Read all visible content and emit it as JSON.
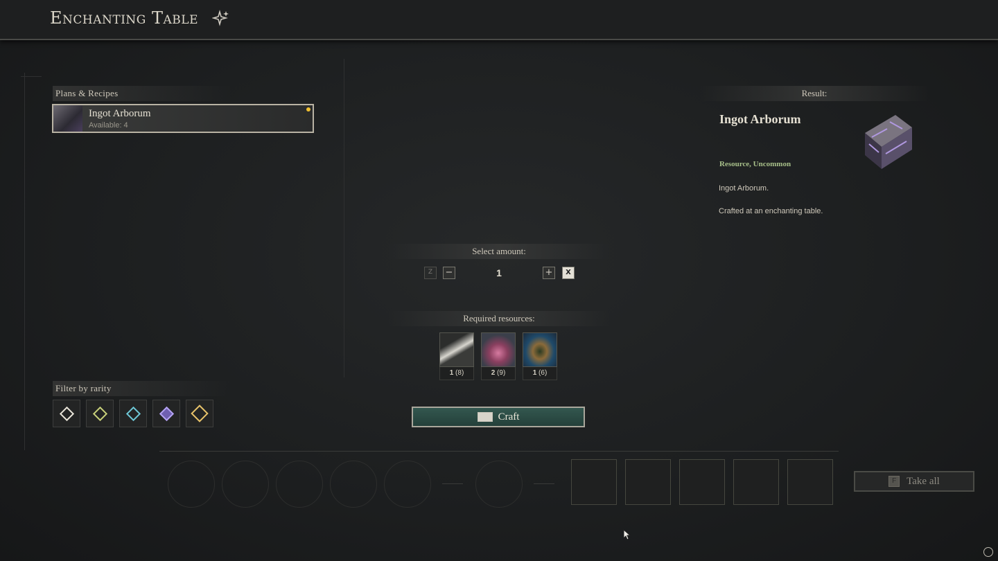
{
  "window": {
    "title": "Enchanting Table"
  },
  "plans": {
    "label": "Plans & Recipes",
    "items": [
      {
        "name": "Ingot Arborum",
        "available": "Available: 4"
      }
    ]
  },
  "filter": {
    "label": "Filter by rarity",
    "rarities": [
      {
        "name": "common",
        "color": "#e8e4d8"
      },
      {
        "name": "uncommon",
        "color": "#c8d07a"
      },
      {
        "name": "rare",
        "color": "#6ec7d6"
      },
      {
        "name": "epic",
        "color": "#b3a2f0"
      },
      {
        "name": "legendary",
        "color": "#e8c36a"
      }
    ]
  },
  "amount": {
    "label": "Select amount:",
    "min_key": "Z",
    "minus": "−",
    "value": "1",
    "plus": "+",
    "max_key": "X"
  },
  "resources": {
    "label": "Required resources:",
    "items": [
      {
        "icon": "blade-resource-icon",
        "count": "1",
        "have": "(8)"
      },
      {
        "icon": "crystal-resource-icon",
        "count": "2",
        "have": "(9)"
      },
      {
        "icon": "ring-resource-icon",
        "count": "1",
        "have": "(6)"
      }
    ]
  },
  "craft": {
    "label": "Craft"
  },
  "result": {
    "label": "Result:",
    "name": "Ingot Arborum",
    "type": "Resource, Uncommon",
    "desc1": "Ingot Arborum.",
    "desc2": "Crafted at an enchanting table."
  },
  "take_all": {
    "key": "F",
    "label": "Take all"
  }
}
